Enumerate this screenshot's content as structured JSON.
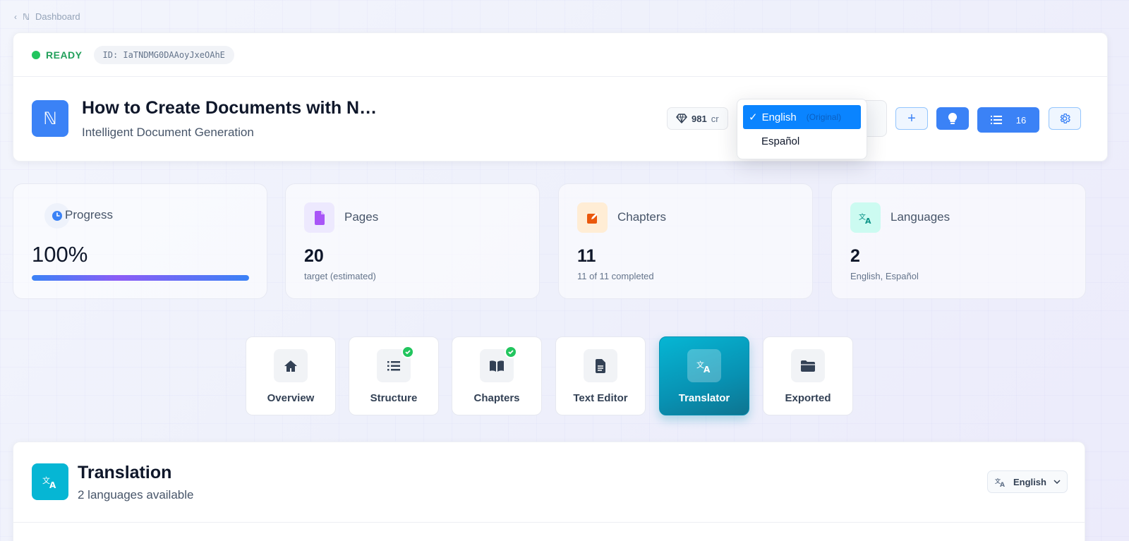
{
  "breadcrumb": {
    "back_icon": "chevron-left-icon",
    "logo": "ℕ",
    "label": "Dashboard"
  },
  "status": {
    "label": "READY",
    "color": "#22c55e",
    "id_text": "ID: IaTNDMG0DAAoyJxeOAhE"
  },
  "document": {
    "logo": "ℕ",
    "title": "How to Create Documents with N…",
    "subtitle": "Intelligent Document Generation"
  },
  "credits": {
    "value": "981",
    "unit": "cr",
    "icon": "diamond-icon"
  },
  "toolbar": {
    "add_icon": "plus-icon",
    "idea_icon": "lightbulb-icon",
    "list_icon": "list-icon",
    "list_count": "16",
    "settings_icon": "gear-icon"
  },
  "language_dropdown": {
    "selected": {
      "check": "✓",
      "label": "English",
      "tag": "(Original)"
    },
    "options": [
      {
        "label": "Español"
      }
    ]
  },
  "stats": {
    "progress": {
      "label": "Progress",
      "value": "100%",
      "fraction": 1.0,
      "icon": "clock-icon"
    },
    "pages": {
      "label": "Pages",
      "value": "20",
      "sub": "target (estimated)",
      "icon": "file-icon"
    },
    "chapters": {
      "label": "Chapters",
      "value": "11",
      "sub": "11 of 11 completed",
      "icon": "edit-icon"
    },
    "languages": {
      "label": "Languages",
      "value": "2",
      "sub": "English, Español",
      "icon": "translate-icon"
    }
  },
  "tabs": [
    {
      "label": "Overview",
      "icon": "home-icon",
      "completed": false,
      "active": false
    },
    {
      "label": "Structure",
      "icon": "list-icon",
      "completed": true,
      "active": false
    },
    {
      "label": "Chapters",
      "icon": "book-icon",
      "completed": true,
      "active": false
    },
    {
      "label": "Text Editor",
      "icon": "document-icon",
      "completed": false,
      "active": false
    },
    {
      "label": "Translator",
      "icon": "translate-icon",
      "completed": false,
      "active": true
    },
    {
      "label": "Exported",
      "icon": "folder-icon",
      "completed": false,
      "active": false
    }
  ],
  "translation": {
    "title": "Translation",
    "subtitle": "2 languages available",
    "icon": "translate-icon",
    "language_select": "English"
  },
  "colors": {
    "accent": "#3b82f6",
    "active_tab": "#0891b2",
    "success": "#22c55e"
  }
}
